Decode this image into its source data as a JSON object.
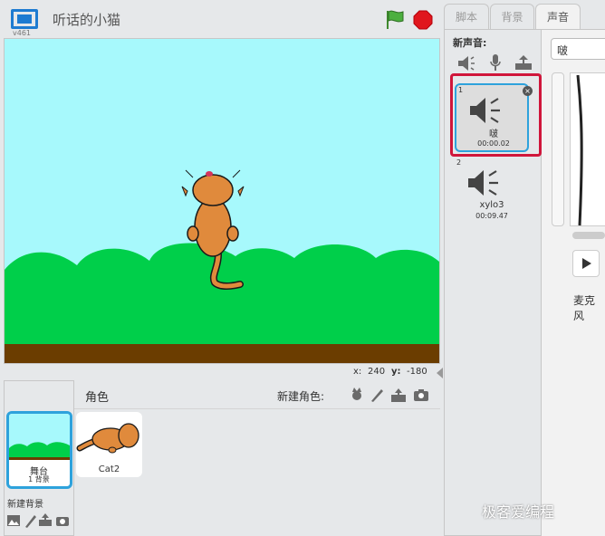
{
  "header": {
    "version": "v461",
    "project_title": "听话的小猫"
  },
  "stage": {
    "sky_color": "#a7f9fc",
    "bush_color": "#00cf4a",
    "ground_color": "#6b3d00"
  },
  "coords": {
    "x_label": "x:",
    "x_value": "240",
    "y_label": "y:",
    "y_value": "-180"
  },
  "sprites_pane": {
    "sprites_label": "角色",
    "new_sprite_label": "新建角色:",
    "stage_thumb_name": "舞台",
    "stage_thumb_count": "1 背景",
    "new_backdrop_label": "新建背景",
    "sprites": [
      {
        "name": "Cat2"
      }
    ]
  },
  "tabs": [
    {
      "label": "脚本",
      "active": false
    },
    {
      "label": "背景",
      "active": false
    },
    {
      "label": "声音",
      "active": true
    }
  ],
  "sounds_panel": {
    "new_sound_label": "新声音:",
    "sounds": [
      {
        "index": "1",
        "name": "啵",
        "duration": "00:00.02",
        "selected": true
      },
      {
        "index": "2",
        "name": "xylo3",
        "duration": "00:09.47",
        "selected": false
      }
    ]
  },
  "editor": {
    "sound_name_value": "啵",
    "mic_label": "麦克风"
  },
  "watermark": "极客爱编程",
  "colors": {
    "accent_blue": "#2ea2dc",
    "highlight_red": "#d0163b",
    "stop_red": "#e0161d",
    "flag_green": "#3f8a2e"
  }
}
